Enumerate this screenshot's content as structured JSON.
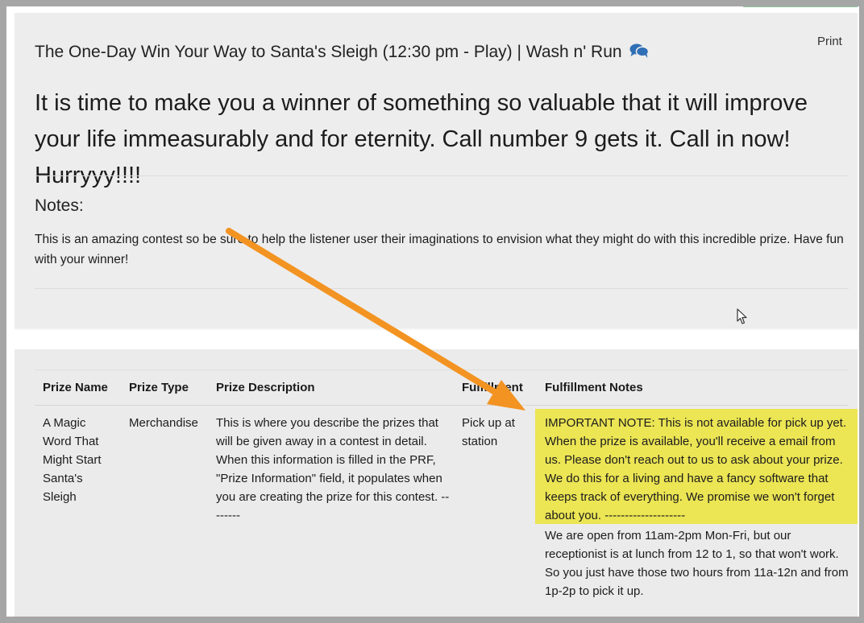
{
  "header": {
    "print_label": "Print",
    "contest_title": "The One-Day Win Your Way to Santa's Sleigh (12:30 pm - Play) | Wash n' Run",
    "chat_icon": "comments-icon"
  },
  "script": {
    "text": "It is time to make you a winner of something so valuable that it will improve your life immeasurably and for eternity. Call number 9 gets it. Call in now! Hurryyy!!!!"
  },
  "notes": {
    "heading": "Notes:",
    "text": "This is an amazing contest so be sure to help the listener user their imaginations to envision what they might do with this incredible prize. Have fun with your winner!"
  },
  "prize_table": {
    "headers": {
      "name": "Prize Name",
      "type": "Prize Type",
      "description": "Prize Description",
      "fulfillment": "Fulfillment",
      "fulfillment_notes": "Fulfillment Notes"
    },
    "rows": [
      {
        "name": "A Magic Word That Might Start Santa's Sleigh",
        "type": "Merchandise",
        "description": "This is where you describe the prizes that will be given away in a contest in detail. When this information is filled in the PRF, \"Prize Information\" field, it populates when you are creating the prize for this contest. --------",
        "fulfillment": "Pick up at station",
        "notes_important": "IMPORTANT NOTE: This is not available for pick up yet. When the prize is available, you'll receive a email from us. Please don't reach out to us to ask about your prize. We do this for a living and have a fancy software that keeps track of everything. We promise we won't forget about you. --------------------",
        "notes_hours": "We are open from 11am-2pm Mon-Fri, but our receptionist is at lunch from 12 to 1, so that won't work. So you just have those two hours from 11a-12n and from 1p-2p to pick it up."
      }
    ]
  },
  "colors": {
    "highlight": "#ece554",
    "arrow": "#f39322",
    "chat_icon": "#2f6fb5",
    "panel": "#ededed",
    "frame": "#a6a6a6"
  }
}
